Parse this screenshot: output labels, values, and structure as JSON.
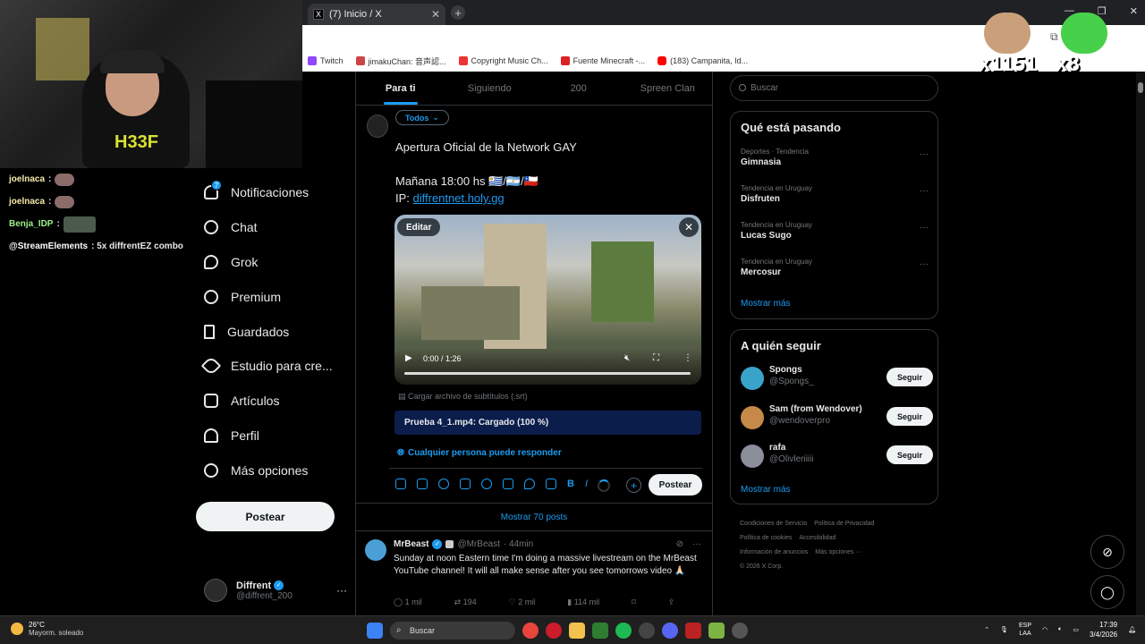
{
  "browser": {
    "tab_title": "(7) Inicio / X",
    "bookmarks": [
      "Twitch",
      "jimakuChan: 音声認...",
      "Copyright Music Ch...",
      "Fuente Minecraft -...",
      "(183) Campanita, Id..."
    ]
  },
  "stream": {
    "chat": [
      {
        "user": "joelnaca",
        "msg": ":"
      },
      {
        "user": "joelnaca",
        "msg": ":"
      },
      {
        "user": "Benja_IDP",
        "msg": ":"
      },
      {
        "user": "@StreamElements",
        "msg": ": 5x diffrentEZ combo"
      }
    ],
    "counters": [
      "x1151",
      "x8"
    ],
    "shirt_text": "H33F"
  },
  "nav": {
    "items": [
      {
        "label": "Notificaciones",
        "icon": "bell-icon",
        "badge": "7"
      },
      {
        "label": "Chat",
        "icon": "chat-icon"
      },
      {
        "label": "Grok",
        "icon": "grok-icon"
      },
      {
        "label": "Premium",
        "icon": "premium-icon"
      },
      {
        "label": "Guardados",
        "icon": "bookmark-icon"
      },
      {
        "label": "Estudio para cre...",
        "icon": "rocket-icon"
      },
      {
        "label": "Artículos",
        "icon": "article-icon"
      },
      {
        "label": "Perfil",
        "icon": "profile-icon"
      },
      {
        "label": "Más opciones",
        "icon": "more-circle-icon"
      }
    ],
    "post_button": "Postear",
    "account": {
      "name": "Diffrent",
      "handle": "@diffrent_200"
    }
  },
  "main": {
    "tabs": [
      "Para ti",
      "Siguiendo",
      "200",
      "Spreen Clan"
    ],
    "active_tab": "Para ti",
    "composer": {
      "audience": "Todos",
      "line1": "Apertura Oficial de la Network GAY",
      "line2": "Mañana 18:00 hs 🇺🇾/🇦🇷/🇨🇱",
      "ip_label": "IP: ",
      "ip_link": "diffrentnet.holy.gg",
      "edit_label": "Editar",
      "video_time": "0:00 / 1:26",
      "subtitles": "Cargar archivo de subtítulos (.srt)",
      "upload_status": "Prueba 4_1.mp4: Cargado (100 %)",
      "reply_setting": "Cualquier persona puede responder",
      "post_label": "Postear"
    },
    "show_more": "Mostrar 70 posts",
    "tweet": {
      "name": "MrBeast",
      "handle": "@MrBeast",
      "time": "· 44min",
      "text": "Sunday at noon Eastern time I'm doing a massive livestream on the MrBeast YouTube channel! It will all make sense after you see tomorrows video 🙏🏻",
      "replies": "1 mil",
      "retweets": "194",
      "likes": "2 mil",
      "views": "114 mil"
    }
  },
  "sidebar": {
    "search_placeholder": "Buscar",
    "trends_title": "Qué está pasando",
    "trends": [
      {
        "context": "Deportes · Tendencia",
        "topic": "Gimnasia"
      },
      {
        "context": "Tendencia en Uruguay",
        "topic": "Disfruten"
      },
      {
        "context": "Tendencia en Uruguay",
        "topic": "Lucas Sugo"
      },
      {
        "context": "Tendencia en Uruguay",
        "topic": "Mercosur"
      }
    ],
    "trends_more": "Mostrar más",
    "follow_title": "A quién seguir",
    "follow": [
      {
        "name": "Spongs",
        "handle": "@Spongs_",
        "button": "Seguir",
        "color": "#3aa3c9"
      },
      {
        "name": "Sam (from Wendover)",
        "handle": "@wendoverpro",
        "button": "Seguir",
        "color": "#c58a4a"
      },
      {
        "name": "rafa",
        "handle": "@Olivleriiiii",
        "button": "Seguir",
        "color": "#8a8f99"
      }
    ],
    "follow_more": "Mostrar más",
    "footer": [
      "Condiciones de Servicio",
      "Política de Privacidad",
      "Política de cookies",
      "Accesibilidad",
      "Información de anuncios",
      "Más opciones ···",
      "© 2026 X Corp."
    ]
  },
  "taskbar": {
    "temp": "26°C",
    "weather": "Mayorm. soleado",
    "search": "Buscar",
    "lang1": "ESP",
    "lang2": "LAA",
    "time": "17:39",
    "date": "3/4/2026"
  },
  "colors": {
    "accent": "#1d9bf0",
    "background": "#000000",
    "text": "#e7e9ea",
    "muted": "#71767b"
  }
}
